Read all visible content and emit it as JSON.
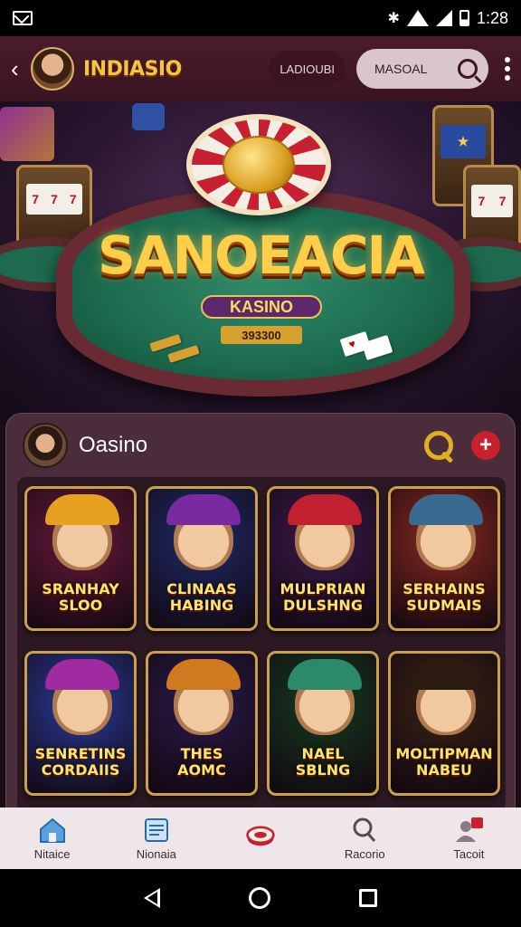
{
  "status_bar": {
    "time": "1:28"
  },
  "header": {
    "brand": "INDIASIO",
    "link_label": "LADIOUBI",
    "search_value": "MASOAL"
  },
  "hero": {
    "title": "SANOEACIA",
    "badge": "KASINO",
    "sub": "393300"
  },
  "panel": {
    "title": "Oasino",
    "games": [
      {
        "label_line1": "SRANHAY",
        "label_line2": "SLOO",
        "bg": "#6a1a3a",
        "hat": "#e8a020"
      },
      {
        "label_line1": "CLINAAS",
        "label_line2": "HABING",
        "bg": "#1e2a6a",
        "hat": "#7a2aa0"
      },
      {
        "label_line1": "MULPRIAN",
        "label_line2": "DULSHNG",
        "bg": "#3a1a4a",
        "hat": "#c02030"
      },
      {
        "label_line1": "SERHAINS",
        "label_line2": "SUDMAIS",
        "bg": "#8a2a20",
        "hat": "#3a6a90"
      },
      {
        "label_line1": "SENRETINS",
        "label_line2": "CORDAIIS",
        "bg": "#2a3a9a",
        "hat": "#a02aa0"
      },
      {
        "label_line1": "THES",
        "label_line2": "AOMC",
        "bg": "#2a1a4a",
        "hat": "#d07a20"
      },
      {
        "label_line1": "NAEL",
        "label_line2": "SBLNG",
        "bg": "#163a1e",
        "hat": "#2a8a6a"
      },
      {
        "label_line1": "MOLTIPMAN",
        "label_line2": "NABEU",
        "bg": "#3a2214",
        "hat": "#2a1a10"
      }
    ]
  },
  "nav": {
    "items": [
      {
        "label": "Nitaice"
      },
      {
        "label": "Nionaia"
      },
      {
        "label": ""
      },
      {
        "label": "Racorio"
      },
      {
        "label": "Tacoit"
      }
    ]
  },
  "colors": {
    "accent": "#f5c542",
    "header_bg": "#4a1b2c",
    "panel_bg": "#4a2c3a"
  }
}
